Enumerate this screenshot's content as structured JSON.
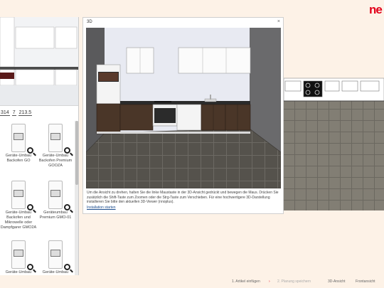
{
  "header": {
    "logo_text": "ne"
  },
  "left_panel": {
    "coords": [
      "314",
      "7",
      "213.5"
    ],
    "catalog": [
      {
        "label": "Geräte-Umbau Backofen GO"
      },
      {
        "label": "Geräte-Umbau Backofen Premium GOOZA"
      },
      {
        "label": "Geräte-Umbau Backofen und Mikrowelle oder Dampfgarer GMO2A"
      },
      {
        "label": "Geräteumbau Premium GMO-01"
      },
      {
        "label": "Geräte-Umbau"
      },
      {
        "label": "Geräte-Umbau"
      }
    ]
  },
  "view3d": {
    "title": "3D",
    "close_label": "×",
    "hint": "Um die Ansicht zu drehen, halten Sie die linke Maustaste in der 3D-Ansicht gedrückt und bewegen die Maus. Drücken Sie zusätzlich die Shift-Taste zum Zoomen oder die Strg-Taste zum Verschieben. Für eine hochwertigere 3D-Darstellung installieren Sie bitte den aktuellen 3D-Viewer (nnoplus).",
    "install_link": "Installation starten"
  },
  "footer": {
    "step1": "1. Artikel einfügen",
    "step2": "2. Planung speichern",
    "view3d": "3D-Ansicht",
    "floorplan": "Frontansicht"
  },
  "colors": {
    "brand": "#e2001a",
    "background": "#fdf2e7",
    "cabinet_wood": "#4a3628",
    "floor_tile": "#6b6860"
  }
}
